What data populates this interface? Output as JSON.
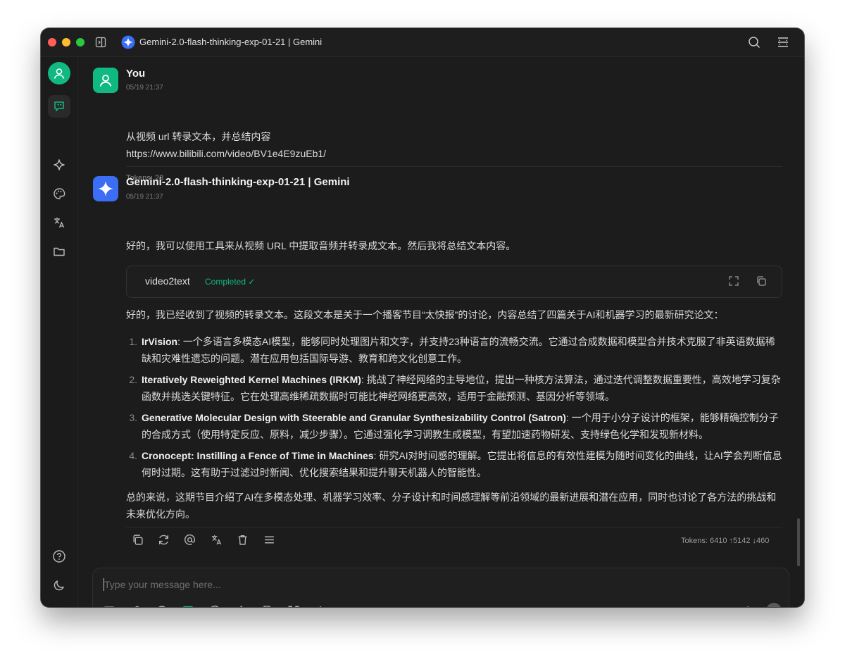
{
  "window": {
    "title": "Gemini-2.0-flash-thinking-exp-01-21 | Gemini"
  },
  "user_message": {
    "name": "You",
    "time": "05/19 21:37",
    "lines": [
      "从视频 url 转录文本，并总结内容",
      "https://www.bilibili.com/video/BV1e4E9zuEb1/"
    ],
    "tokens": "Tokens: 28"
  },
  "assistant_message": {
    "name": "Gemini-2.0-flash-thinking-exp-01-21 | Gemini",
    "time": "05/19 21:37",
    "intro": "好的，我可以使用工具来从视频 URL 中提取音频并转录成文本。然后我将总结文本内容。",
    "tool": {
      "name": "video2text",
      "status": "Completed ✓"
    },
    "summary_intro": "好的，我已经收到了视频的转录文本。这段文本是关于一个播客节目“太快报”的讨论，内容总结了四篇关于AI和机器学习的最新研究论文：",
    "items": [
      {
        "num": "1.",
        "title": "IrVision",
        "text": ": 一个多语言多模态AI模型，能够同时处理图片和文字，并支持23种语言的流畅交流。它通过合成数据和模型合并技术克服了非英语数据稀缺和灾难性遗忘的问题。潜在应用包括国际导游、教育和跨文化创意工作。"
      },
      {
        "num": "2.",
        "title": "Iteratively Reweighted Kernel Machines (IRKM)",
        "text": ": 挑战了神经网络的主导地位，提出一种核方法算法，通过迭代调整数据重要性，高效地学习复杂函数并挑选关键特征。它在处理高维稀疏数据时可能比神经网络更高效，适用于金融预测、基因分析等领域。"
      },
      {
        "num": "3.",
        "title": "Generative Molecular Design with Steerable and Granular Synthesizability Control (Satron)",
        "text": ": 一个用于小分子设计的框架，能够精确控制分子的合成方式（使用特定反应、原料，减少步骤）。它通过强化学习调教生成模型，有望加速药物研发、支持绿色化学和发现新材料。"
      },
      {
        "num": "4.",
        "title": "Cronocept: Instilling a Fence of Time in Machines",
        "text": ": 研究AI对时间感的理解。它提出将信息的有效性建模为随时间变化的曲线，让AI学会判断信息何时过期。这有助于过滤过时新闻、优化搜索结果和提升聊天机器人的智能性。"
      }
    ],
    "conclusion": "总的来说，这期节目介绍了AI在多模态处理、机器学习效率、分子设计和时间感理解等前沿领域的最新进展和潜在应用，同时也讨论了各方法的挑战和未来优化方向。",
    "tokens": "Tokens: 6410 ↑5142 ↓460"
  },
  "input": {
    "placeholder": "Type your message here..."
  },
  "icons": {
    "sidebar": [
      "user-avatar-icon",
      "chat-icon",
      "sparkle-icon",
      "palette-icon",
      "translate-icon",
      "folder-icon",
      "help-icon",
      "moon-icon",
      "gear-icon"
    ],
    "actions": [
      "copy-icon",
      "refresh-icon",
      "at-icon",
      "translate-icon",
      "trash-icon",
      "menu-icon"
    ],
    "input_tools": [
      "new-topic-icon",
      "attachment-icon",
      "globe-icon",
      "terminal-icon",
      "at-icon",
      "lightning-icon",
      "brush-icon",
      "expand-icon",
      "eraser-icon",
      "translate-icon",
      "send-icon"
    ]
  },
  "colors": {
    "accent": "#10b981",
    "gemini": "#3b6ef5"
  }
}
